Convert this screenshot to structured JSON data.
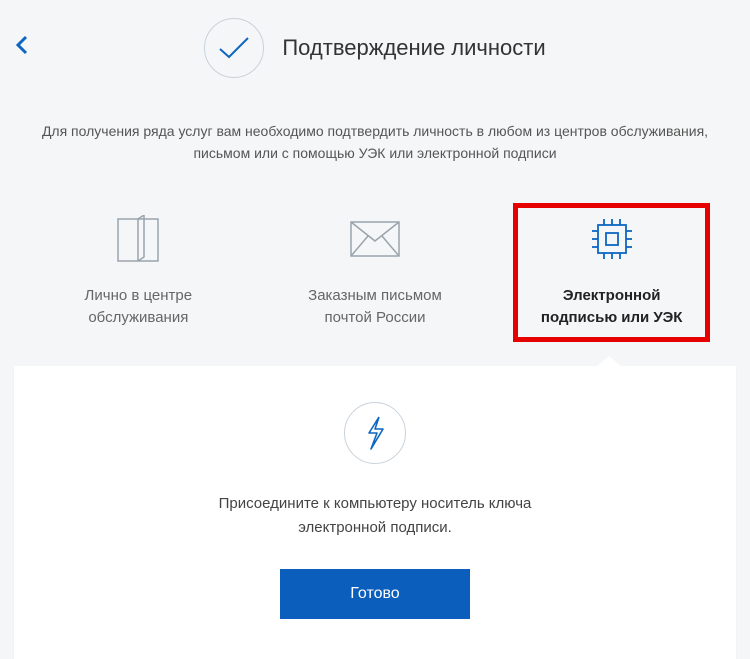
{
  "header": {
    "title": "Подтверждение личности"
  },
  "subtitle": {
    "line1": "Для получения ряда услуг вам необходимо подтвердить личность в любом из центров обслуживания,",
    "line2": "письмом или с помощью УЭК или электронной подписи"
  },
  "options": [
    {
      "label_line1": "Лично в центре",
      "label_line2": "обслуживания"
    },
    {
      "label_line1": "Заказным письмом",
      "label_line2": "почтой России"
    },
    {
      "label_line1": "Электронной",
      "label_line2": "подписью или УЭК"
    }
  ],
  "detail": {
    "instruction_line1": "Присоедините к компьютеру носитель ключа",
    "instruction_line2": "электронной подписи.",
    "button_label": "Готово"
  },
  "colors": {
    "accent": "#0b5ebb",
    "icon_stroke": "#0d66c2",
    "highlight_border": "#e60000"
  }
}
